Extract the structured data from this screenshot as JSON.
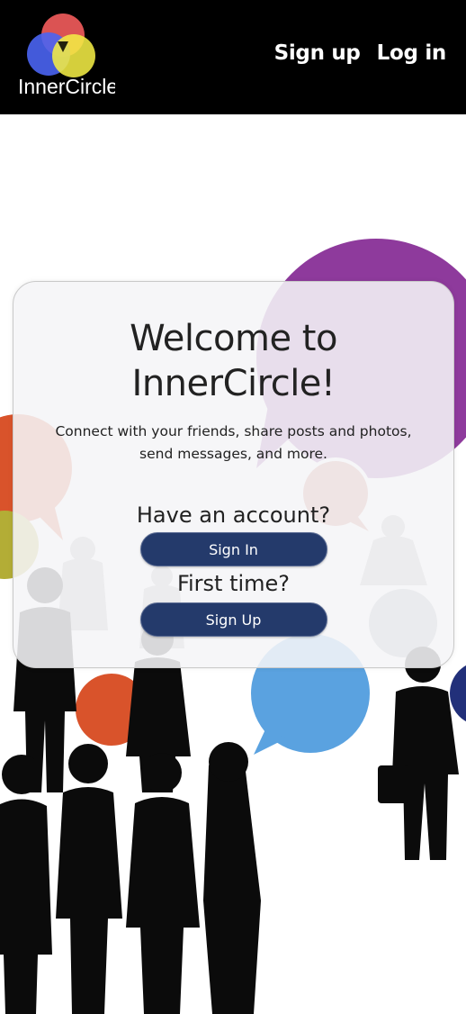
{
  "header": {
    "logo_text": "InnerCircle",
    "nav": {
      "signup_label": "Sign up",
      "login_label": "Log in"
    }
  },
  "welcome": {
    "title_line1": "Welcome to",
    "title_line2": "InnerCircle!",
    "description_line1": "Connect with your friends, share posts and photos,",
    "description_line2": "send messages, and more."
  },
  "account": {
    "have_account_label": "Have an account?",
    "sign_in_button": "Sign In",
    "first_time_label": "First time?",
    "sign_up_button": "Sign Up"
  },
  "icons": {
    "logo": "venn-circles-logo"
  },
  "colors": {
    "navbar_bg": "#000000",
    "button_bg": "#243a6b",
    "bubble_purple": "#8e3a9c",
    "bubble_orange": "#d9532b",
    "bubble_blue": "#5aa2e0",
    "bubble_olive": "#b3ad36",
    "bubble_navy": "#22307a",
    "silhouette": "#0b0b0b"
  }
}
